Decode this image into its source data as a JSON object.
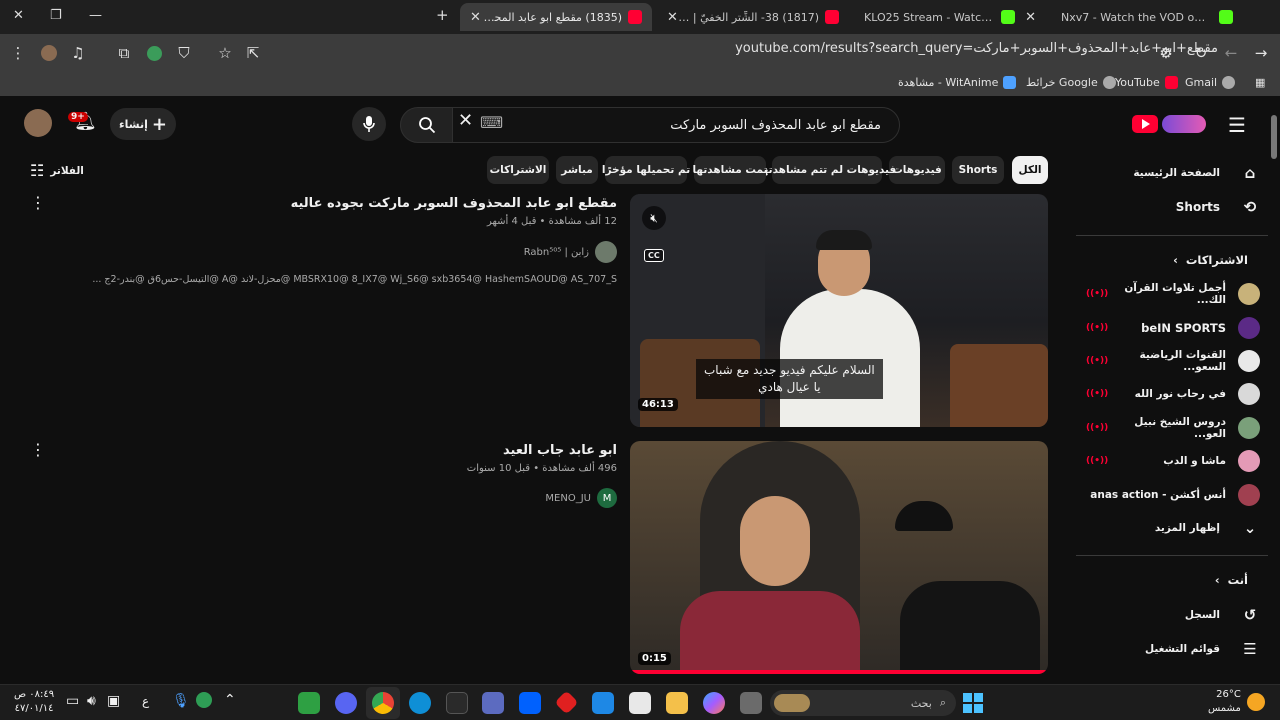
{
  "tabs": [
    {
      "label": "Nxv7 - Watch the VOD on Kick",
      "color": "#53fc18"
    },
    {
      "label": "KLO25 Stream - Watch Live on",
      "color": "#53fc18"
    },
    {
      "label": "(1817) 38- الشِّتر الخفيّ | بودكاس...",
      "color": "#ff0033"
    },
    {
      "label": "(1835) مقطع ابو عابد المحذوف ال",
      "color": "#ff0033"
    }
  ],
  "new_tab": "+",
  "url": "youtube.com/results?search_query=مقطع+ابو+عابد+المحذوف+السوبر+ماركت",
  "bookmarks": [
    {
      "label": "Gmail",
      "color": "#aaaaaa"
    },
    {
      "label": "YouTube",
      "color": "#ff0033"
    },
    {
      "label": "خرائط Google",
      "color": "#aaaaaa"
    },
    {
      "label": "مشاهدة - WitAnime",
      "color": "#4ea1ff"
    }
  ],
  "youtube": {
    "search_value": "مقطع ابو عابد المحذوف السوبر ماركت",
    "keyboard_glyph": "⌨",
    "create_label": "إنشاء",
    "notif_count": "9+",
    "filters_label": "الفلاتر",
    "chips": [
      "الكل",
      "Shorts",
      "فيديوهات",
      "فيديوهات لم تتم مشاهدتها",
      "تمت مشاهدتها",
      "تم تحميلها مؤخرًا",
      "مباشر",
      "الاشتراكات"
    ]
  },
  "sidebar": {
    "home": "الصفحة الرئيسية",
    "shorts": "Shorts",
    "subscriptions_heading": "الاشتراكات",
    "subscriptions": [
      {
        "name": "أجمل تلاوات القرآن الك...",
        "color": "#c8b27a",
        "live": true
      },
      {
        "name": "beIN SPORTS",
        "color": "#5b2a86",
        "live": true
      },
      {
        "name": "القنوات الرياضية السعو...",
        "color": "#e8e8e8",
        "live": true
      },
      {
        "name": "في رحاب نور الله",
        "color": "#d9d9d9",
        "live": true
      },
      {
        "name": "دروس الشيخ نبيل العو...",
        "color": "#7aa07a",
        "live": true
      },
      {
        "name": "ماشا و الدب",
        "color": "#e49ab6",
        "live": true
      },
      {
        "name": "أنس أكشن - anas action",
        "color": "#a04050",
        "live": false
      }
    ],
    "show_more": "إظهار المزيد",
    "you_heading": "أنت",
    "history": "السجل",
    "playlists": "قوائم التشغيل"
  },
  "results": [
    {
      "title": "مقطع ابو عابد المحذوف السوبر ماركت بجوده عاليه",
      "views": "12 ألف مشاهدة",
      "age": "قبل 4 أشهر",
      "channel": "زابن | Rabn⁵⁰⁵",
      "description": "... التيسل-حس6ق @بندر-2ج@ A@ محزل-لاند@ MBSRX10@ 8_IX7@ Wj_S6@ sxb3654@ HashemSAOUD@ AS_707_S",
      "duration": "46:13",
      "caption_line1": "السلام عليكم فيديو جديد مع شباب",
      "caption_line2": "يا عيال هادي",
      "cc": "CC"
    },
    {
      "title": "ابو عابد جاب العيد",
      "views": "496 ألف مشاهدة",
      "age": "قبل 10 سنوات",
      "channel": "MENO_JU",
      "channel_initial": "M",
      "duration": "0:15"
    }
  ],
  "taskbar": {
    "search_label": "بحث",
    "weather_temp": "26°C",
    "weather_desc": "مشمس",
    "time": "٠٨:٤٩ ص",
    "date": "٤٧/٠١/١٤",
    "lang": "ع"
  }
}
